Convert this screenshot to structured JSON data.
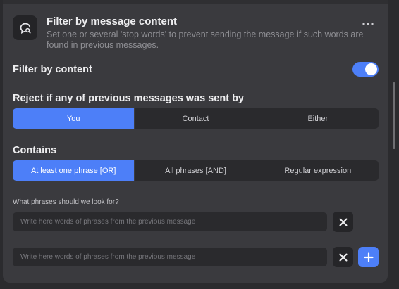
{
  "header": {
    "title": "Filter by message content",
    "description": "Set one or several 'stop words' to prevent sending the message if such words are found in previous messages.",
    "icon": "message-search-icon",
    "more_icon": "more-horizontal-icon"
  },
  "filter_by_content": {
    "label": "Filter by content",
    "enabled": true
  },
  "reject_sender": {
    "label": "Reject if any of previous messages was sent by",
    "options": [
      "You",
      "Contact",
      "Either"
    ],
    "selected": "You"
  },
  "contains": {
    "label": "Contains",
    "options": [
      "At least one phrase [OR]",
      "All phrases [AND]",
      "Regular expression"
    ],
    "selected": "At least one phrase [OR]"
  },
  "phrases": {
    "label": "What phrases should we look for?",
    "inputs": [
      {
        "value": "",
        "placeholder": "Write here words of phrases from the previous message"
      },
      {
        "value": "",
        "placeholder": "Write here words of phrases from the previous message"
      }
    ],
    "clear_icon": "close-icon",
    "add_icon": "plus-icon"
  },
  "colors": {
    "accent": "#4d7ff8",
    "panel": "#3a3a3e",
    "field": "#2a2a2d"
  }
}
